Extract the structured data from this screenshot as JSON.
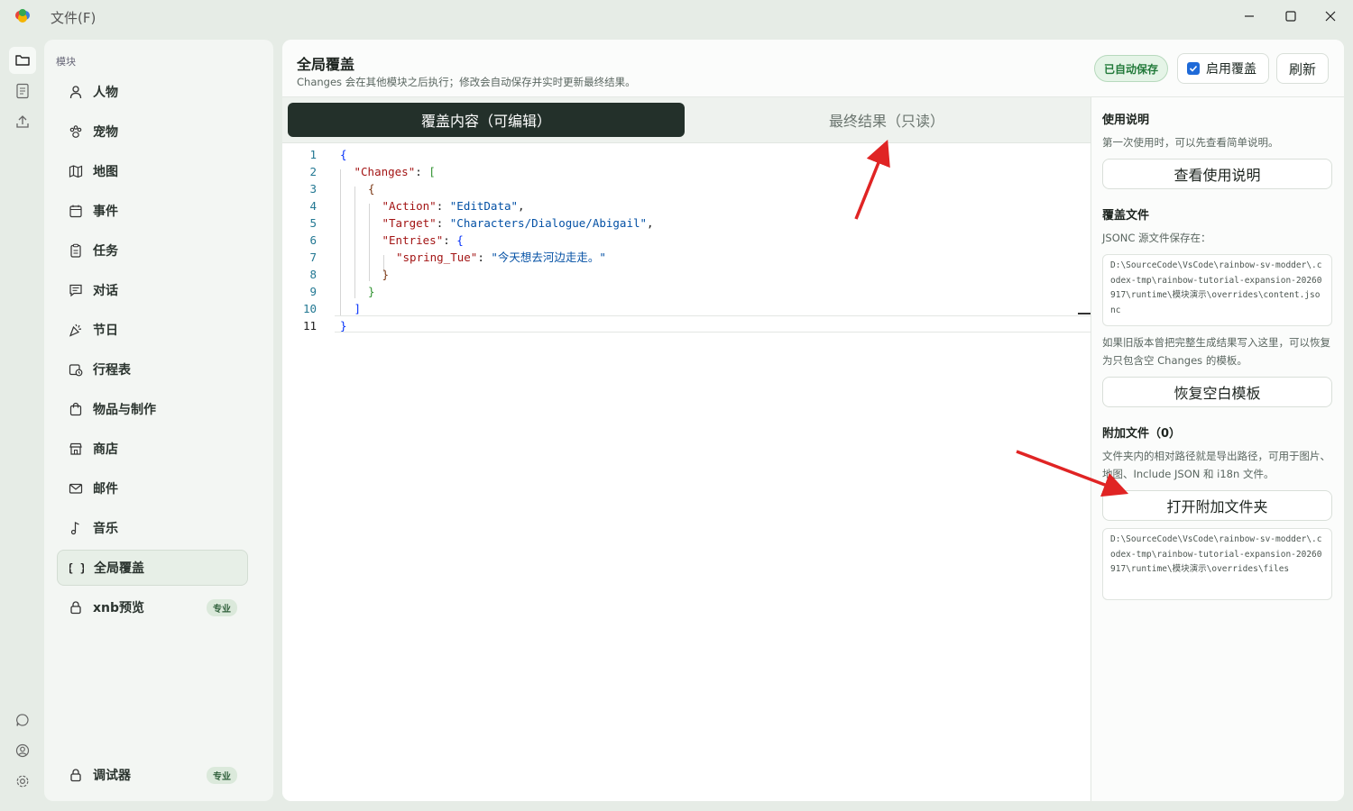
{
  "window": {
    "menu_file": "文件(F)",
    "logo_icon": "app-logo-icon",
    "minimize_icon": "minimize-icon",
    "maximize_icon": "maximize-icon",
    "close_icon": "close-icon"
  },
  "rail": {
    "top": [
      "folder-icon",
      "document-icon",
      "upload-icon"
    ],
    "bottom": [
      "chat-icon",
      "user-circle-icon",
      "gear-icon"
    ]
  },
  "sidebar": {
    "title": "模块",
    "items": [
      {
        "label": "人物",
        "icon": "person-icon"
      },
      {
        "label": "宠物",
        "icon": "paw-icon"
      },
      {
        "label": "地图",
        "icon": "map-icon"
      },
      {
        "label": "事件",
        "icon": "calendar-icon"
      },
      {
        "label": "任务",
        "icon": "clipboard-icon"
      },
      {
        "label": "对话",
        "icon": "message-icon"
      },
      {
        "label": "节日",
        "icon": "party-icon"
      },
      {
        "label": "行程表",
        "icon": "schedule-icon"
      },
      {
        "label": "物品与制作",
        "icon": "bag-icon"
      },
      {
        "label": "商店",
        "icon": "store-icon"
      },
      {
        "label": "邮件",
        "icon": "mail-icon"
      },
      {
        "label": "音乐",
        "icon": "music-note-icon"
      },
      {
        "label": "全局覆盖",
        "icon": "braces-icon",
        "active": true
      },
      {
        "label": "xnb预览",
        "icon": "lock-icon",
        "badge": "专业"
      }
    ],
    "debugger": {
      "label": "调试器",
      "icon": "lock-icon",
      "badge": "专业"
    }
  },
  "header": {
    "title": "全局覆盖",
    "description": "Changes 会在其他模块之后执行；修改会自动保存并实时更新最终结果。",
    "saved_badge": "已自动保存",
    "enable_label": "启用覆盖",
    "enable_checked": true,
    "refresh_label": "刷新"
  },
  "tabs": {
    "edit": "覆盖内容（可编辑）",
    "result": "最终结果（只读）",
    "active": "edit"
  },
  "editor": {
    "current_line": 11,
    "lines": [
      {
        "n": "1",
        "code": "{"
      },
      {
        "n": "2",
        "code": "\"Changes\": ["
      },
      {
        "n": "3",
        "code": "{"
      },
      {
        "n": "4",
        "code": "\"Action\": \"EditData\","
      },
      {
        "n": "5",
        "code": "\"Target\": \"Characters/Dialogue/Abigail\","
      },
      {
        "n": "6",
        "code": "\"Entries\": {"
      },
      {
        "n": "7",
        "code": "\"spring_Tue\": \"今天想去河边走走。\""
      },
      {
        "n": "8",
        "code": "}"
      },
      {
        "n": "9",
        "code": "}"
      },
      {
        "n": "10",
        "code": "]"
      },
      {
        "n": "11",
        "code": "}"
      }
    ]
  },
  "right": {
    "usage_title": "使用说明",
    "usage_text": "第一次使用时，可以先查看简单说明。",
    "usage_button": "查看使用说明",
    "file_title": "覆盖文件",
    "file_text": "JSONC 源文件保存在：",
    "file_path": "D:\\SourceCode\\VsCode\\rainbow-sv-modder\\.codex-tmp\\rainbow-tutorial-expansion-20260917\\runtime\\模块演示\\overrides\\content.jsonc",
    "restore_text": "如果旧版本曾把完整生成结果写入这里，可以恢复为只包含空 Changes 的模板。",
    "restore_button": "恢复空白模板",
    "attach_title": "附加文件（0）",
    "attach_text": "文件夹内的相对路径就是导出路径，可用于图片、地图、Include JSON 和 i18n 文件。",
    "attach_button": "打开附加文件夹",
    "attach_path": "D:\\SourceCode\\VsCode\\rainbow-sv-modder\\.codex-tmp\\rainbow-tutorial-expansion-20260917\\runtime\\模块演示\\overrides\\files"
  },
  "colors": {
    "accent_dark": "#23302a",
    "saved_green": "#227a3a",
    "annotation_red": "#e02424",
    "checkbox_blue": "#1f6ad8"
  }
}
